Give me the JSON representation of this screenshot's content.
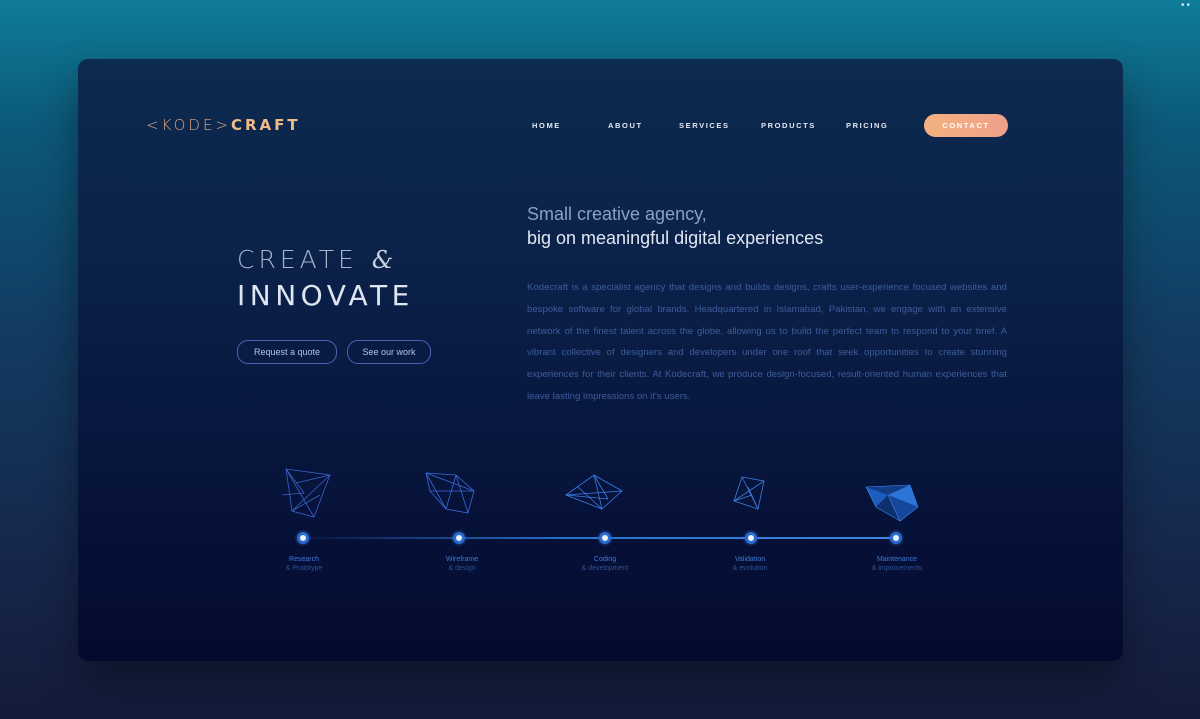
{
  "window": {
    "corner_dots": "••"
  },
  "header": {
    "logo": {
      "part1": "<KODE>",
      "part2": "CRAFT"
    },
    "nav": [
      "HOME",
      "ABOUT",
      "SERVICES",
      "PRODUCTS",
      "PRICING"
    ],
    "contact_label": "CONTACT"
  },
  "hero": {
    "line1_word": "CREATE",
    "line1_amp": "&",
    "line2": "INNOVATE",
    "buttons": {
      "quote": "Request a quote",
      "work": "See our work"
    }
  },
  "intro": {
    "tagline1": "Small creative agency,",
    "tagline2": "big on meaningful digital experiences",
    "body": "Kodecraft is a specialist agency that designs and builds designs, crafts user-experience focused websites and bespoke software for global brands. Headquartered in Islamabad, Pakistan, we engage with an extensive network of the finest talent across the globe, allowing us to build the perfect team to respond to your brief. A vibrant collective of designers and developers under one roof that seek opportunities to create stunning experiences for their clients. At Kodecraft, we produce design-focused, result-oriented human experiences that leave lasting impressions on it's users."
  },
  "process": {
    "steps": [
      {
        "title": "Research",
        "subtitle": "& Prototype"
      },
      {
        "title": "Wireframe",
        "subtitle": "& design"
      },
      {
        "title": "Coding",
        "subtitle": "& development"
      },
      {
        "title": "Validation",
        "subtitle": "& evolution"
      },
      {
        "title": "Maintenance",
        "subtitle": "& improvements"
      }
    ]
  },
  "colors": {
    "accent": "#f2ad84",
    "logo": "#e9b084",
    "timeline": "#2b6bd1",
    "frame_bg": "#0b2149"
  }
}
